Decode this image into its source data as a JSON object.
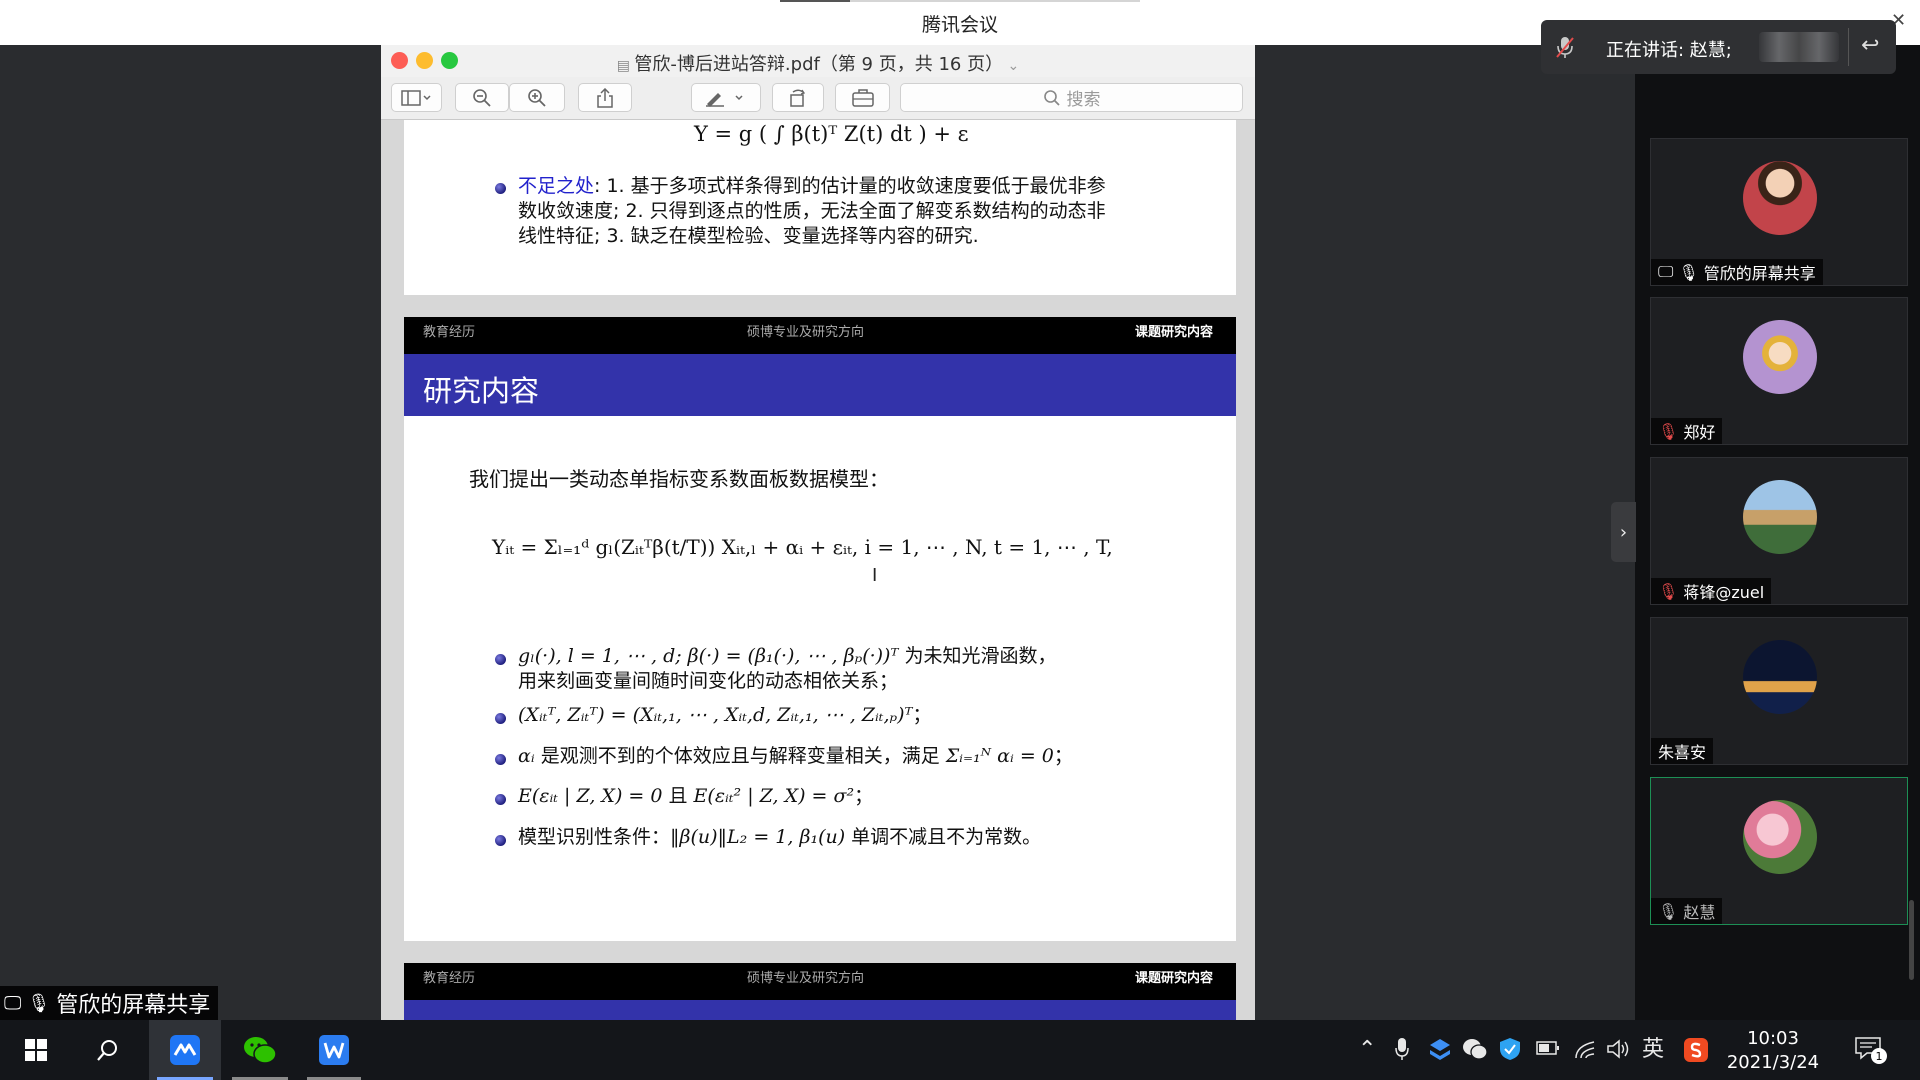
{
  "app": {
    "title": "腾讯会议",
    "controls": {
      "minimize": "–",
      "restore": "❐",
      "close": "✕"
    }
  },
  "speaking": {
    "label": "正在讲话: 赵慧;"
  },
  "pdf": {
    "title": "管欣-博后进站答辩.pdf（第 9 页，共 16 页）",
    "search_placeholder": "搜索"
  },
  "slide_top": {
    "equation": "Y = g ( ∫ β(t)ᵀ Z(t) dt ) + ε",
    "shortcoming_label": "不足之处",
    "shortcoming_lines": [
      ": 1. 基于多项式样条得到的估计量的收敛速度要低于最优非参",
      "数收敛速度; 2. 只得到逐点的性质，无法全面了解变系数结构的动态非",
      "线性特征; 3. 缺乏在模型检验、变量选择等内容的研究."
    ]
  },
  "slide": {
    "nav": [
      "教育经历",
      "硕博专业及研究方向",
      "课题研究内容"
    ],
    "title": "研究内容",
    "intro": "我们提出一类动态单指标变系数面板数据模型：",
    "model": "Yᵢₜ = Σₗ₌₁ᵈ gₗ(Zᵢₜᵀβ(t/T)) Xᵢₜ,ₗ + αᵢ + εᵢₜ, i = 1, ⋯ , N, t = 1, ⋯ , T,",
    "bullets": [
      {
        "math": "gₗ(·), l = 1, ⋯ , d;  β(·) = (β₁(·), ⋯ , βₚ(·))ᵀ",
        "text": " 为未知光滑函数，",
        "line2": "用来刻画变量间随时间变化的动态相依关系；"
      },
      {
        "math": "(Xᵢₜᵀ, Zᵢₜᵀ) = (Xᵢₜ,₁, ⋯ , Xᵢₜ,d, Zᵢₜ,₁, ⋯ , Zᵢₜ,ₚ)ᵀ",
        "text": "；"
      },
      {
        "pre": "αᵢ",
        "text": " 是观测不到的个体效应且与解释变量相关，满足 ",
        "math": "Σᵢ₌₁ᴺ αᵢ = 0",
        "post": "；"
      },
      {
        "math": "E(εᵢₜ | Z, X) = 0",
        "text": " 且 ",
        "math2": "E(εᵢₜ² | Z, X) = σ²",
        "post": "；"
      },
      {
        "text": "模型识别性条件：",
        "math": "‖β(u)‖L₂ = 1,  β₁(u)",
        "post": " 单调不减且不为常数。"
      }
    ]
  },
  "participants": [
    {
      "name": "管欣的屏幕共享",
      "status": "sharing"
    },
    {
      "name": "郑好",
      "status": "muted"
    },
    {
      "name": "蒋锋@zuel",
      "status": "muted"
    },
    {
      "name": "朱喜安",
      "status": "none"
    },
    {
      "name": "赵慧",
      "status": "speaking"
    }
  ],
  "share_badge": "管欣的屏幕共享",
  "taskbar": {
    "ime": "英",
    "time": "10:03",
    "date": "2021/3/24",
    "notifications": "1"
  },
  "colors": {
    "beamer_title": "#3333aa",
    "highlight_blue": "#2222cc",
    "active_speaker_border": "#1d8f55",
    "taskbar": "#14161a"
  }
}
